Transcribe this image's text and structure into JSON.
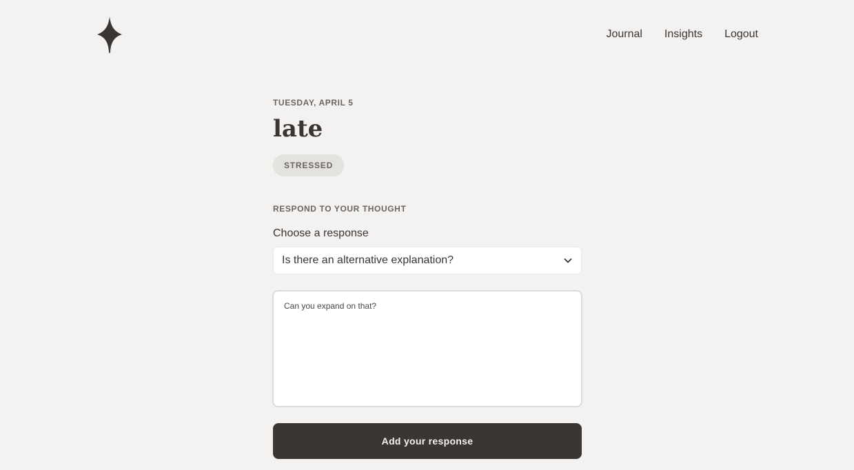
{
  "logo": {
    "icon": "sparkle-star-icon",
    "color": "#3a3633"
  },
  "nav": {
    "items": [
      "Journal",
      "Insights",
      "Logout"
    ]
  },
  "entry": {
    "date": "TUESDAY, APRIL 5",
    "title": "late",
    "mood_badge": "STRESSED"
  },
  "respond": {
    "section_label": "RESPOND TO YOUR THOUGHT",
    "choose_label": "Choose a response",
    "selected_response": "Is there an alternative explanation?",
    "textarea_placeholder": "Can you expand on that?",
    "submit_label": "Add your response"
  },
  "colors": {
    "background": "#f3f2f0",
    "button": "#3a3633",
    "badge": "#e3e2df"
  }
}
